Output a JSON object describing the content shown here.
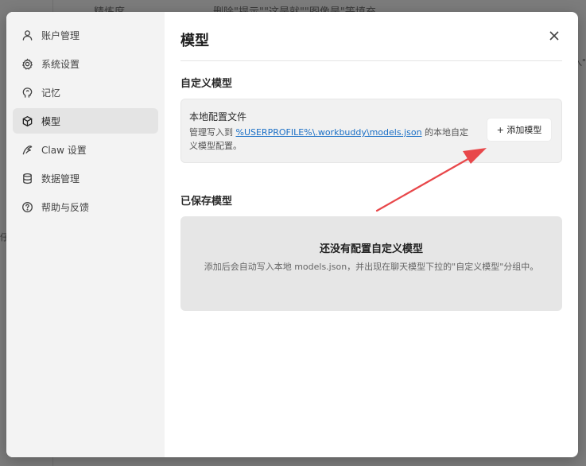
{
  "background": {
    "top_left": "精炼度",
    "top_right": "删除\"提示\"\"这是就\"\"图像是\"等填充",
    "right_fragment": "入\"",
    "left_fragment": "仔"
  },
  "sidebar": {
    "items": [
      {
        "label": "账户管理",
        "icon": "user-icon"
      },
      {
        "label": "系统设置",
        "icon": "gear-icon"
      },
      {
        "label": "记忆",
        "icon": "brain-icon"
      },
      {
        "label": "模型",
        "icon": "cube-icon",
        "active": true
      },
      {
        "label": "Claw 设置",
        "icon": "claw-icon"
      },
      {
        "label": "数据管理",
        "icon": "database-icon"
      },
      {
        "label": "帮助与反馈",
        "icon": "help-icon"
      }
    ]
  },
  "main": {
    "title": "模型",
    "custom_section_label": "自定义模型",
    "config_card": {
      "title": "本地配置文件",
      "desc_prefix": "管理写入到 ",
      "path": "%USERPROFILE%\\.workbuddy\\models.json",
      "desc_suffix": " 的本地自定义模型配置。",
      "add_button": "+ 添加模型"
    },
    "saved_section_label": "已保存模型",
    "empty_state": {
      "title": "还没有配置自定义模型",
      "desc": "添加后会自动写入本地 models.json，并出现在聊天模型下拉的\"自定义模型\"分组中。"
    }
  },
  "colors": {
    "annotation_arrow": "#e8474a",
    "link": "#1a6fc6"
  }
}
